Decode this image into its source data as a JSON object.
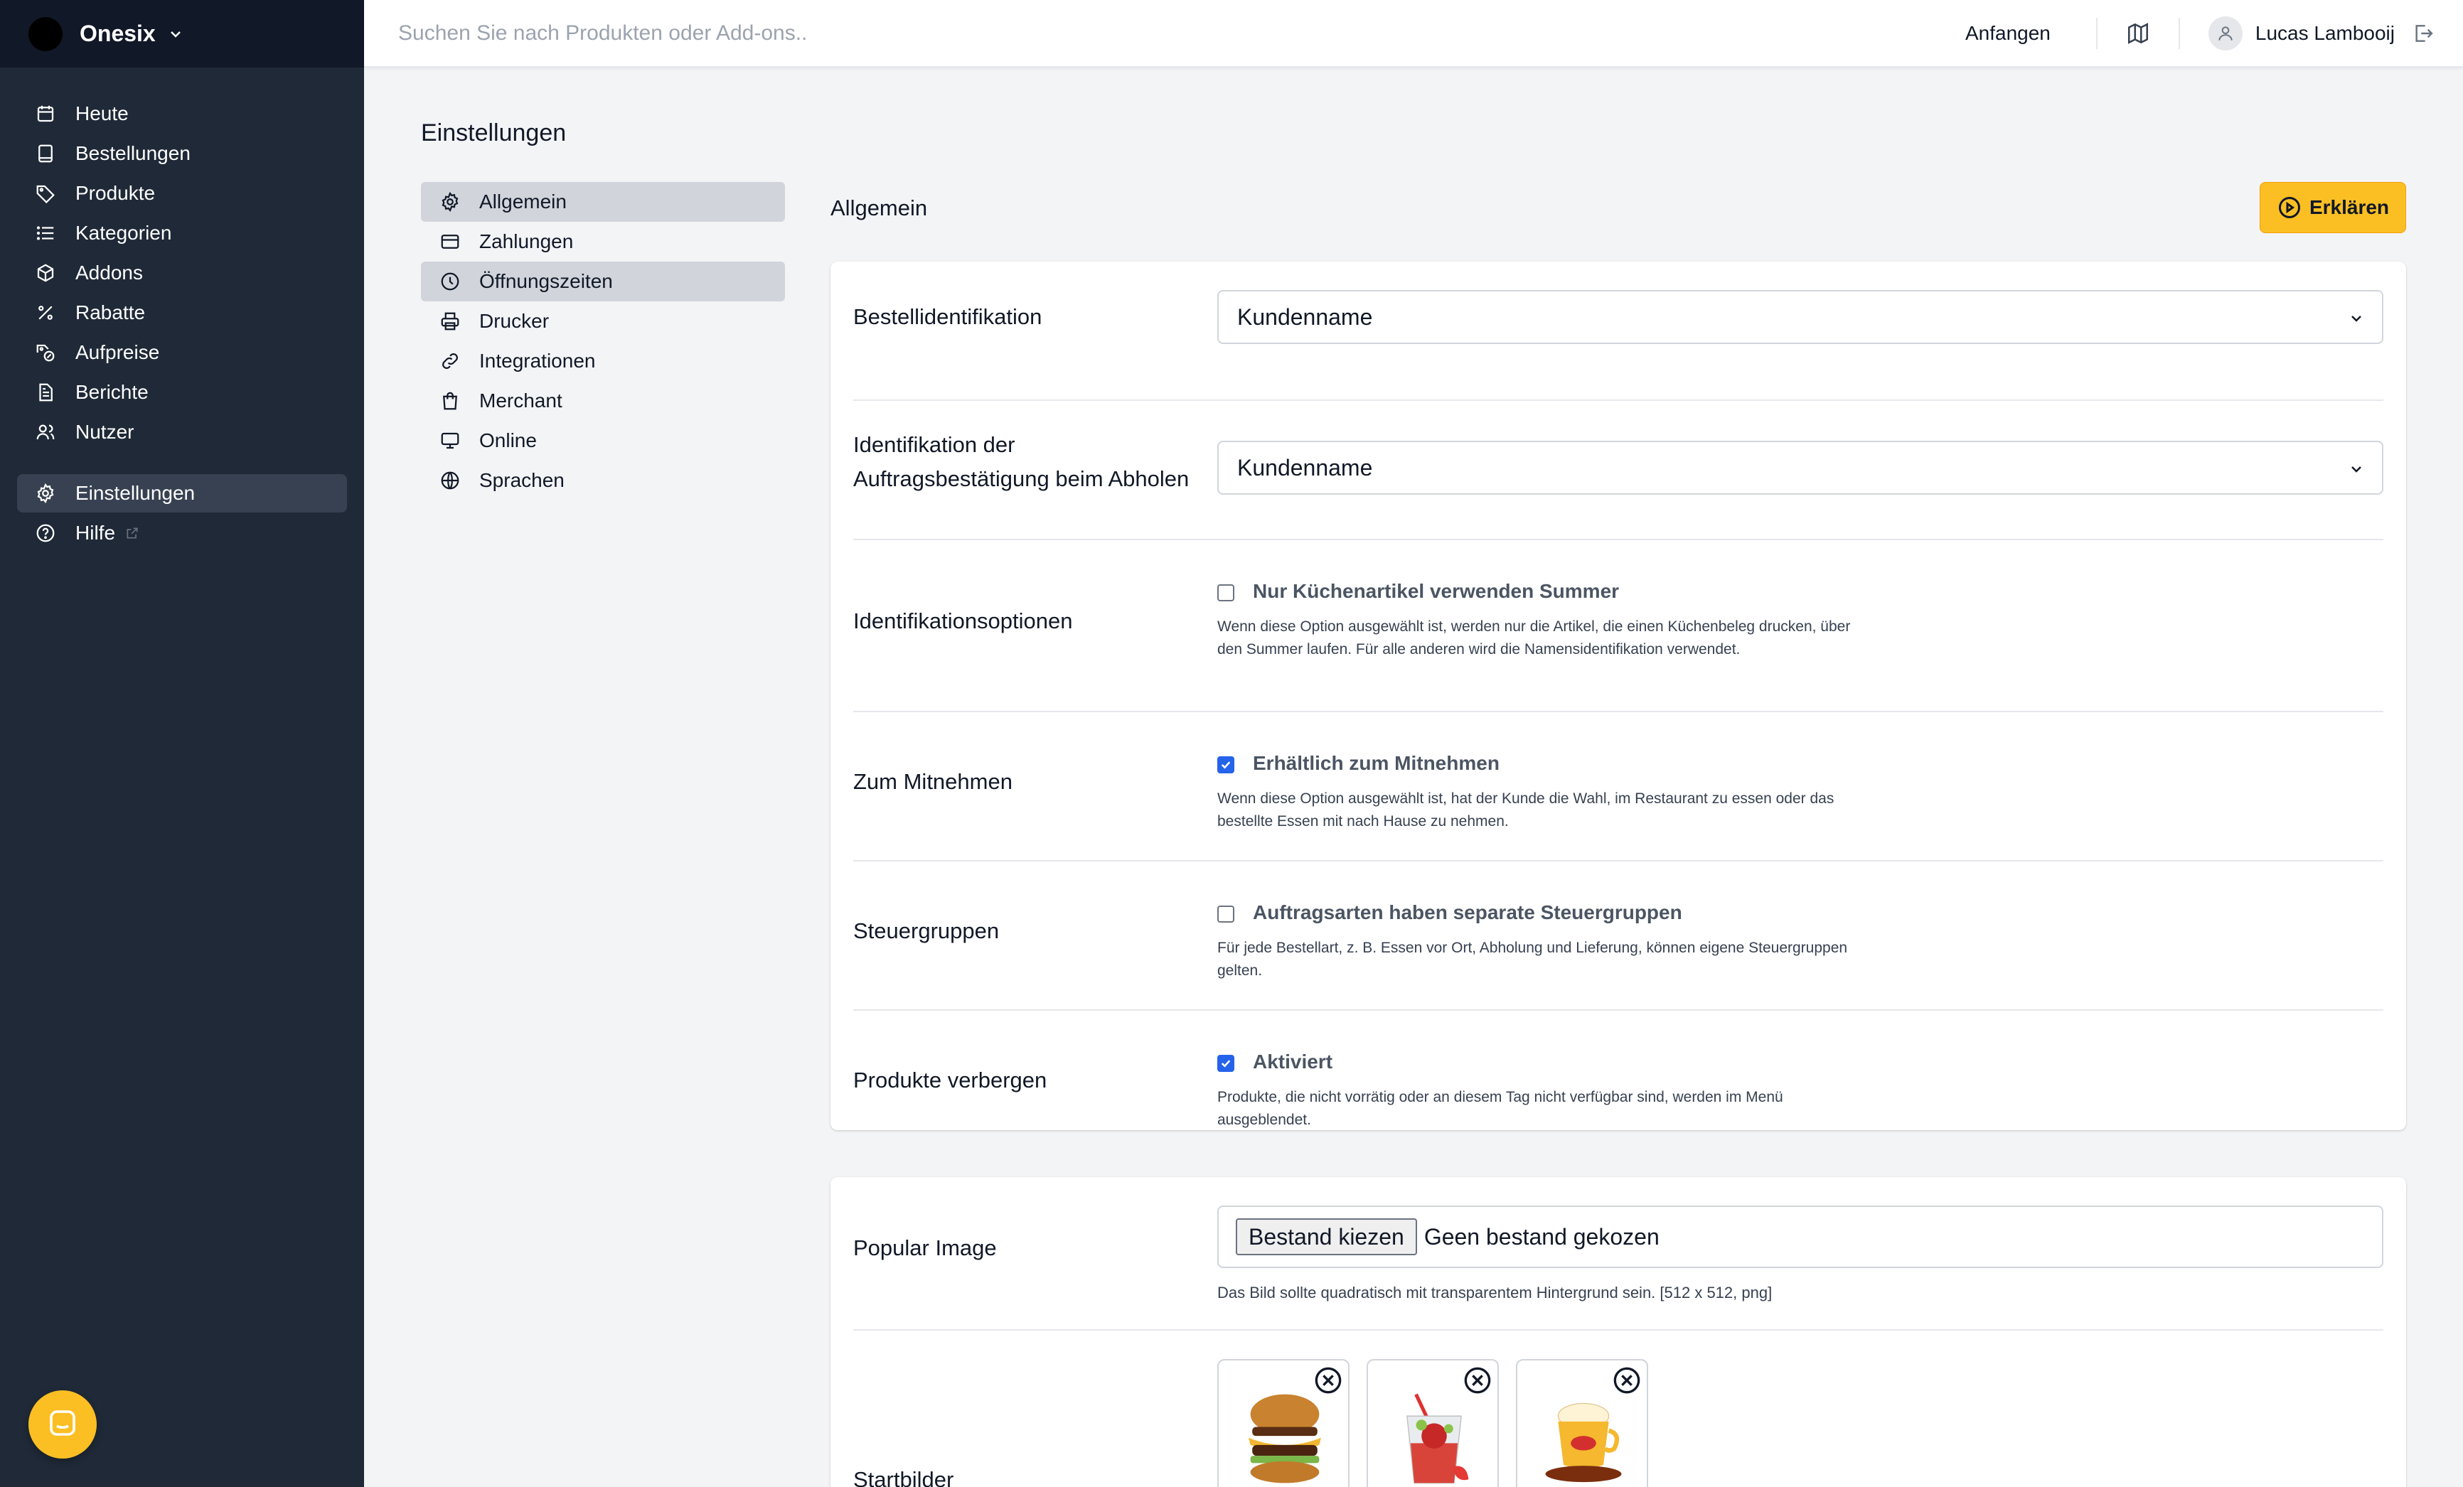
{
  "brand": {
    "name": "Onesix"
  },
  "sidebar": {
    "items": [
      {
        "label": "Heute"
      },
      {
        "label": "Bestellungen"
      },
      {
        "label": "Produkte"
      },
      {
        "label": "Kategorien"
      },
      {
        "label": "Addons"
      },
      {
        "label": "Rabatte"
      },
      {
        "label": "Aufpreise"
      },
      {
        "label": "Berichte"
      },
      {
        "label": "Nutzer"
      }
    ],
    "settings_label": "Einstellungen",
    "help_label": "Hilfe"
  },
  "topbar": {
    "search_placeholder": "Suchen Sie nach Produkten oder Add-ons..",
    "start_label": "Anfangen",
    "user_name": "Lucas Lambooij"
  },
  "page": {
    "title": "Einstellungen"
  },
  "settings_nav": [
    {
      "label": "Allgemein"
    },
    {
      "label": "Zahlungen"
    },
    {
      "label": "Öffnungszeiten"
    },
    {
      "label": "Drucker"
    },
    {
      "label": "Integrationen"
    },
    {
      "label": "Merchant"
    },
    {
      "label": "Online"
    },
    {
      "label": "Sprachen"
    }
  ],
  "section": {
    "title": "Allgemein",
    "explain_label": "Erklären"
  },
  "form": {
    "order_id": {
      "label": "Bestellidentifikation",
      "value": "Kundenname"
    },
    "pickup_id": {
      "label_line1": "Identifikation der",
      "label_line2": "Auftragsbestätigung beim Abholen",
      "value": "Kundenname"
    },
    "id_options": {
      "label": "Identifikationsoptionen",
      "checkbox_label": "Nur Küchenartikel verwenden Summer",
      "checked": false,
      "desc": "Wenn diese Option ausgewählt ist, werden nur die Artikel, die einen Küchenbeleg drucken, über den Summer laufen. Für alle anderen wird die Namensidentifikation verwendet."
    },
    "takeaway": {
      "label": "Zum Mitnehmen",
      "checkbox_label": "Erhältlich zum Mitnehmen",
      "checked": true,
      "desc": "Wenn diese Option ausgewählt ist, hat der Kunde die Wahl, im Restaurant zu essen oder das bestellte Essen mit nach Hause zu nehmen."
    },
    "tax_groups": {
      "label": "Steuergruppen",
      "checkbox_label": "Auftragsarten haben separate Steuergruppen",
      "checked": false,
      "desc": "Für jede Bestellart, z. B. Essen vor Ort, Abholung und Lieferung, können eigene Steuergruppen gelten."
    },
    "hide_products": {
      "label": "Produkte verbergen",
      "checkbox_label": "Aktiviert",
      "checked": true,
      "desc": "Produkte, die nicht vorrätig oder an diesem Tag nicht verfügbar sind, werden im Menü ausgeblendet."
    }
  },
  "images": {
    "popular": {
      "label": "Popular Image",
      "button_label": "Bestand kiezen",
      "file_status": "Geen bestand gekozen",
      "hint": "Das Bild sollte quadratisch mit transparentem Hintergrund sein. [512 x 512, png]"
    },
    "start": {
      "label": "Startbilder"
    }
  },
  "colors": {
    "sidebar": "#1f2937",
    "accent": "#fbbf24",
    "checkbox": "#2563eb"
  }
}
